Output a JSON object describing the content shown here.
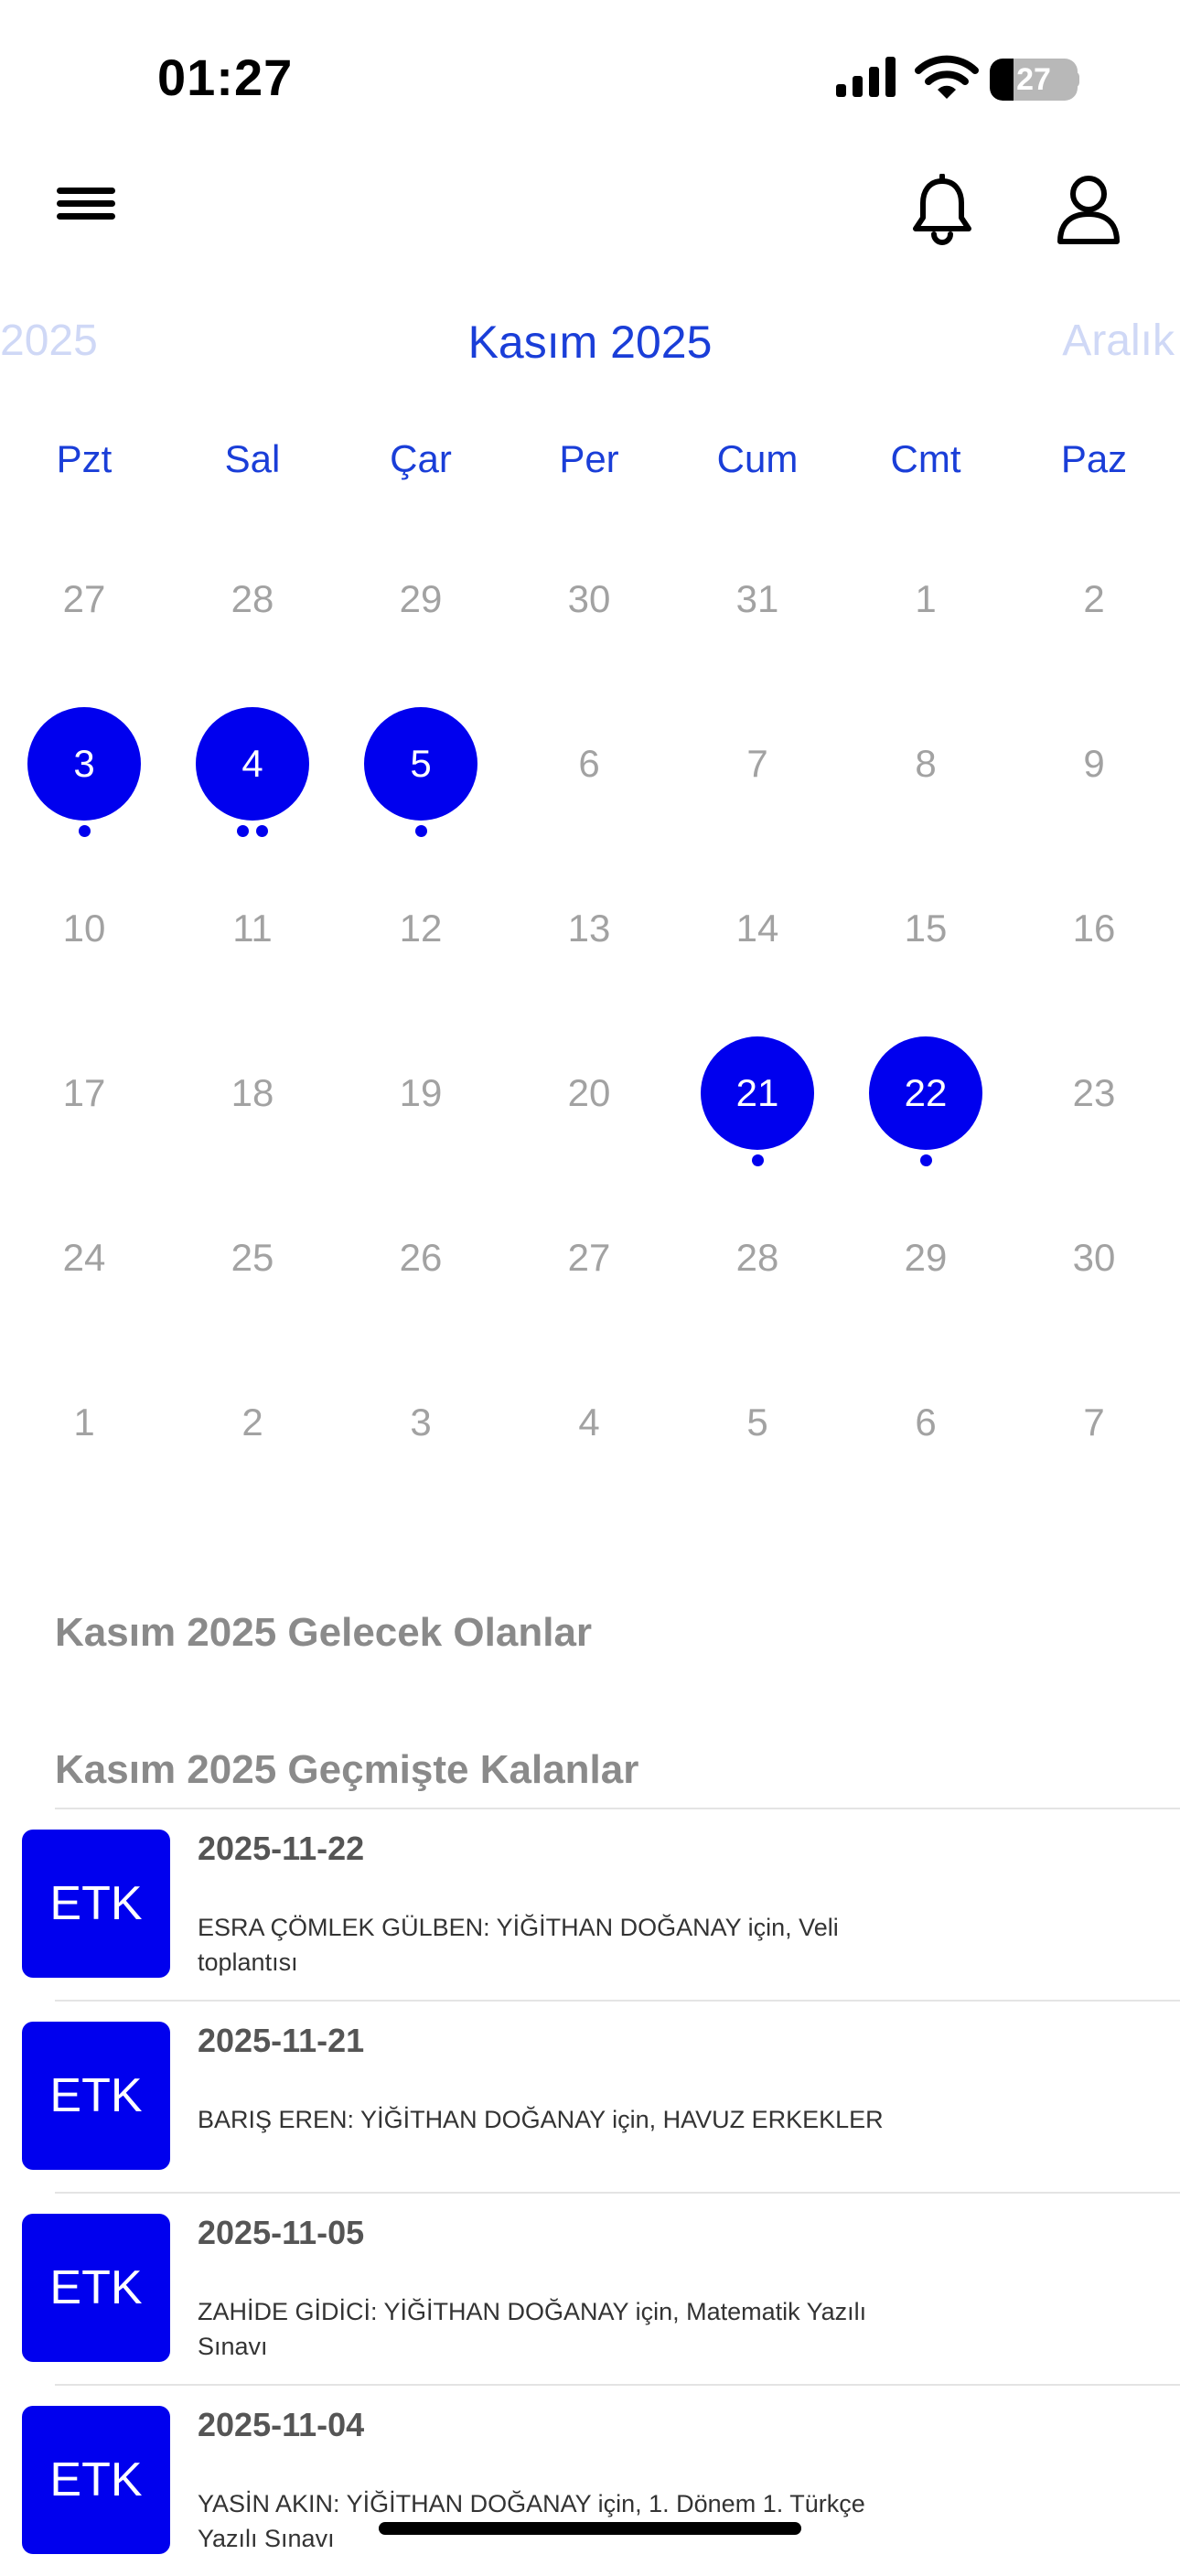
{
  "status_bar": {
    "time": "01:27",
    "battery": "27",
    "battery_level": 0.27
  },
  "calendar": {
    "prev_month": "2025",
    "current_month": "Kasım 2025",
    "next_month": "Aralık",
    "weekdays": [
      "Pzt",
      "Sal",
      "Çar",
      "Per",
      "Cum",
      "Cmt",
      "Paz"
    ],
    "weeks": [
      [
        {
          "d": "27"
        },
        {
          "d": "28"
        },
        {
          "d": "29"
        },
        {
          "d": "30"
        },
        {
          "d": "31"
        },
        {
          "d": "1"
        },
        {
          "d": "2"
        }
      ],
      [
        {
          "d": "3",
          "active": true,
          "dots": 1
        },
        {
          "d": "4",
          "active": true,
          "dots": 2
        },
        {
          "d": "5",
          "active": true,
          "dots": 1
        },
        {
          "d": "6"
        },
        {
          "d": "7"
        },
        {
          "d": "8"
        },
        {
          "d": "9"
        }
      ],
      [
        {
          "d": "10"
        },
        {
          "d": "11"
        },
        {
          "d": "12"
        },
        {
          "d": "13"
        },
        {
          "d": "14"
        },
        {
          "d": "15"
        },
        {
          "d": "16"
        }
      ],
      [
        {
          "d": "17"
        },
        {
          "d": "18"
        },
        {
          "d": "19"
        },
        {
          "d": "20"
        },
        {
          "d": "21",
          "active": true,
          "dots": 1
        },
        {
          "d": "22",
          "active": true,
          "dots": 1
        },
        {
          "d": "23"
        }
      ],
      [
        {
          "d": "24"
        },
        {
          "d": "25"
        },
        {
          "d": "26"
        },
        {
          "d": "27"
        },
        {
          "d": "28"
        },
        {
          "d": "29"
        },
        {
          "d": "30"
        }
      ],
      [
        {
          "d": "1"
        },
        {
          "d": "2"
        },
        {
          "d": "3"
        },
        {
          "d": "4"
        },
        {
          "d": "5"
        },
        {
          "d": "6"
        },
        {
          "d": "7"
        }
      ]
    ]
  },
  "upcoming": {
    "title": "Kasım 2025 Gelecek Olanlar"
  },
  "past": {
    "title": "Kasım 2025 Geçmişte Kalanlar",
    "items": [
      {
        "badge": "ETK",
        "date": "2025-11-22",
        "description": "ESRA ÇÖMLEK GÜLBEN: YİĞİTHAN DOĞANAY için, Veli toplantısı"
      },
      {
        "badge": "ETK",
        "date": "2025-11-21",
        "description": "BARIŞ EREN: YİĞİTHAN DOĞANAY için, HAVUZ ERKEKLER"
      },
      {
        "badge": "ETK",
        "date": "2025-11-05",
        "description": "ZAHİDE GİDİCİ: YİĞİTHAN DOĞANAY için, Matematik Yazılı Sınavı"
      },
      {
        "badge": "ETK",
        "date": "2025-11-04",
        "description": "YASİN AKIN: YİĞİTHAN DOĞANAY için, 1. Dönem 1. Türkçe Yazılı Sınavı"
      }
    ]
  },
  "colors": {
    "accent": "#0000ee",
    "header_blue": "#1a3ed8",
    "muted": "#a2a2a2"
  }
}
